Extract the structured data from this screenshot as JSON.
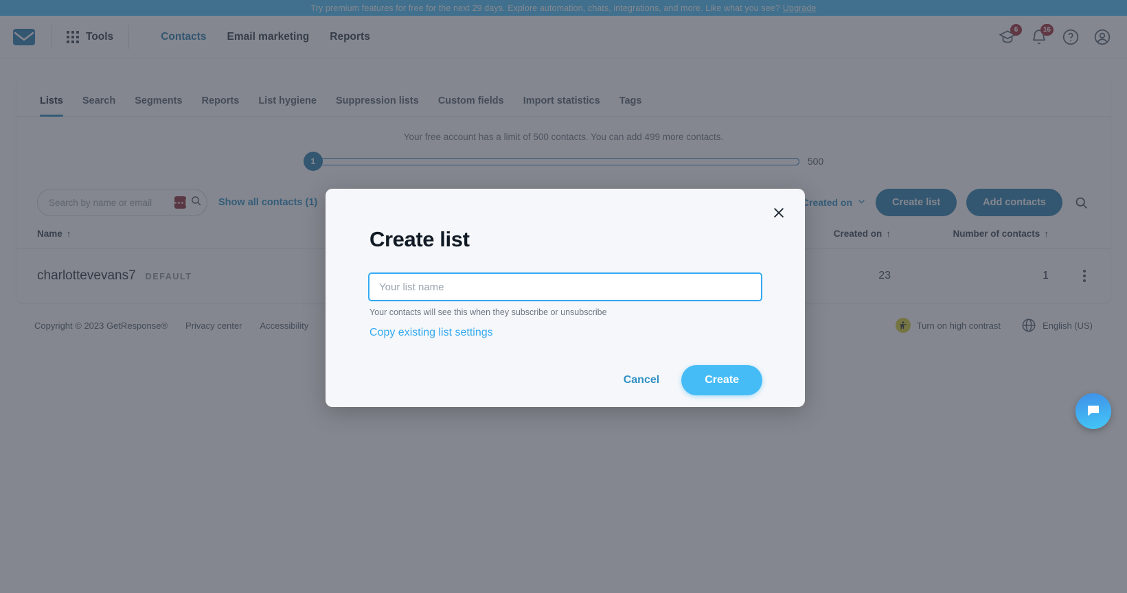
{
  "promo": {
    "text": "Try premium features for free for the next 29 days. Explore automation, chats, integrations, and more. Like what you see?",
    "link_label": "Upgrade",
    "background": "#4cc2fc"
  },
  "topnav": {
    "logo_icon": "envelope-logo-icon",
    "tools_label": "Tools",
    "links": [
      {
        "label": "Contacts",
        "active": true
      },
      {
        "label": "Email marketing",
        "active": false
      },
      {
        "label": "Reports",
        "active": false
      }
    ],
    "icons": {
      "learning_icon": "graduation-cap-icon",
      "learning_badge": "6",
      "notifications_icon": "bell-icon",
      "notifications_badge": "16",
      "help_icon": "help-circle-icon",
      "account_icon": "user-circle-icon"
    }
  },
  "tabs": [
    {
      "label": "Lists",
      "active": true
    },
    {
      "label": "Search",
      "active": false
    },
    {
      "label": "Segments",
      "active": false
    },
    {
      "label": "Reports",
      "active": false
    },
    {
      "label": "List hygiene",
      "active": false
    },
    {
      "label": "Suppression lists",
      "active": false
    },
    {
      "label": "Custom fields",
      "active": false
    },
    {
      "label": "Import statistics",
      "active": false
    },
    {
      "label": "Tags",
      "active": false
    }
  ],
  "limit": {
    "text": "Your free account has a limit of 500 contacts. You can add 499 more contacts.",
    "current": "1",
    "max": "500",
    "accent": "#2c7fb0"
  },
  "toolbar": {
    "search_placeholder": "Search by name or email",
    "search_value": "",
    "password_chip_icon": "password-manager-icon",
    "search_icon": "search-icon",
    "show_all_label": "Show all contacts (1)",
    "sort_label": "Created on",
    "sort_arrow_icon": "sort-descending-icon",
    "sort_caret_icon": "chevron-down-icon",
    "create_list_label": "Create list",
    "add_contacts_label": "Add contacts",
    "right_search_icon": "search-icon"
  },
  "table": {
    "columns": [
      {
        "label": "Name",
        "sort_icon": "arrow-up-icon"
      },
      {
        "label": "Created on",
        "sort_icon": "arrow-up-icon"
      },
      {
        "label": "Number of contacts",
        "sort_icon": "arrow-up-icon"
      }
    ],
    "rows": [
      {
        "name": "charlottevevans7",
        "tag": "DEFAULT",
        "created_on": "23",
        "count": "1",
        "menu_icon": "kebab-menu-icon"
      }
    ]
  },
  "footer": {
    "copyright": "Copyright © 2023 GetResponse®",
    "privacy": "Privacy center",
    "accessibility": "Accessibility",
    "accessibility_widget": "Turn on high contrast",
    "language": "English (US)",
    "accessibility_icon": "accessibility-person-icon",
    "globe_icon": "globe-icon"
  },
  "chat": {
    "icon": "chat-bubble-icon",
    "color": "#44c8f8"
  },
  "modal": {
    "title": "Create list",
    "close_icon": "close-icon",
    "input_placeholder": "Your list name",
    "input_value": "",
    "help_text": "Your contacts will see this when they subscribe or unsubscribe",
    "copy_settings_label": "Copy existing list settings",
    "cancel_label": "Cancel",
    "create_label": "Create",
    "accent": "#46bcf7"
  }
}
